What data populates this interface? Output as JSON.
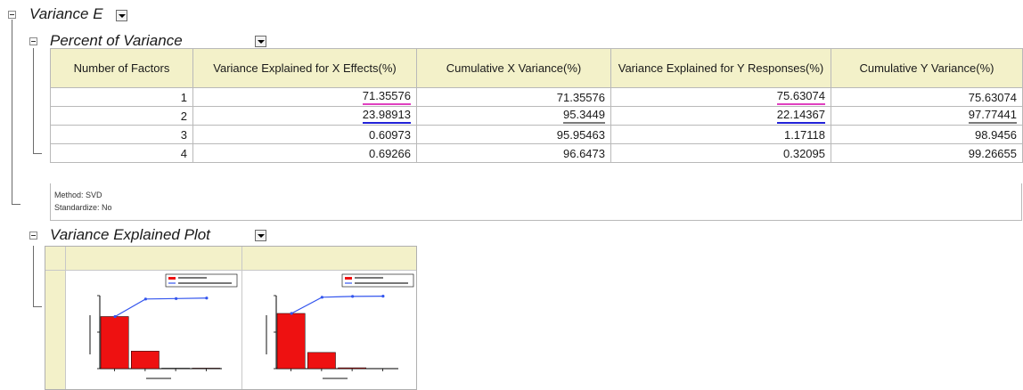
{
  "variance_section": {
    "title": "Variance E"
  },
  "percent_section": {
    "title": "Percent of Variance",
    "headers": [
      "Number of Factors",
      "Variance Explained for X Effects(%)",
      "Cumulative X Variance(%)",
      "Variance Explained for Y Responses(%)",
      "Cumulative Y Variance(%)"
    ],
    "rows": [
      [
        "1",
        "71.35576",
        "71.35576",
        "75.63074",
        "75.63074"
      ],
      [
        "2",
        "23.98913",
        "95.3449",
        "22.14367",
        "97.77441"
      ],
      [
        "3",
        "0.60973",
        "95.95463",
        "1.17118",
        "98.9456"
      ],
      [
        "4",
        "0.69266",
        "96.6473",
        "0.32095",
        "99.26655"
      ]
    ],
    "notes": {
      "method": "Method: SVD",
      "standardize": "Standardize: No"
    }
  },
  "plot_section": {
    "title": "Variance Explained Plot"
  },
  "colors": {
    "header_bg": "#f3f1c9",
    "pink": "#e040c0",
    "blue": "#2222d8",
    "bar_red": "#ee1111",
    "line_blue": "#3355ee"
  },
  "chart_data": [
    {
      "type": "bar",
      "categories": [
        "1",
        "2",
        "3",
        "4"
      ],
      "values": [
        71.35576,
        23.98913,
        0.60973,
        0.69266
      ],
      "cumulative": [
        71.35576,
        95.3449,
        95.95463,
        96.6473
      ],
      "ylim": [
        0,
        100
      ]
    },
    {
      "type": "bar",
      "categories": [
        "1",
        "2",
        "3",
        "4"
      ],
      "values": [
        75.63074,
        22.14367,
        1.17118,
        0.32095
      ],
      "cumulative": [
        75.63074,
        97.77441,
        98.9456,
        99.26655
      ],
      "ylim": [
        0,
        100
      ]
    }
  ]
}
